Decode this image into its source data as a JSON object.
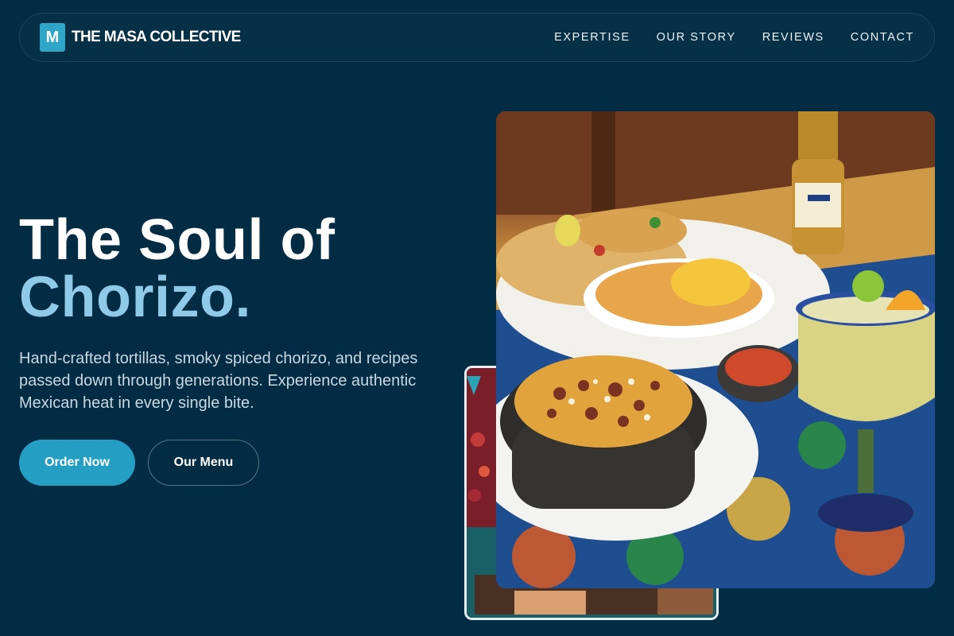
{
  "brand": {
    "mark": "M",
    "name": "THE MASA COLLECTIVE"
  },
  "nav": {
    "items": [
      {
        "label": "EXPERTISE"
      },
      {
        "label": "OUR STORY"
      },
      {
        "label": "REVIEWS"
      },
      {
        "label": "CONTACT"
      }
    ]
  },
  "hero": {
    "title_line1": "The Soul of",
    "title_line2": "Chorizo.",
    "subtitle": "Hand-crafted tortillas, smoky spiced chorizo, and recipes passed down through generations. Experience authentic Mexican heat in every single bite.",
    "primary_cta": "Order Now",
    "secondary_cta": "Our Menu"
  },
  "images": {
    "main_photo": "mexican-food-table-photo",
    "secondary_photo": "restaurant-interior-photo"
  },
  "colors": {
    "background": "#022c43",
    "accent": "#259ec4",
    "headline_highlight": "#8fcbe8"
  }
}
